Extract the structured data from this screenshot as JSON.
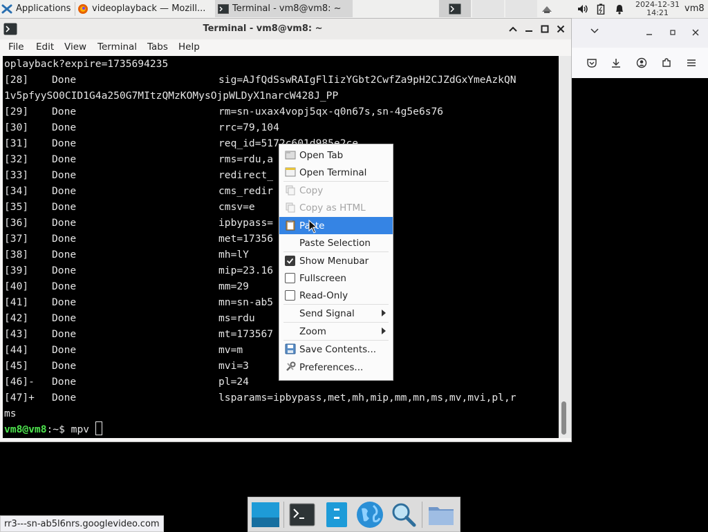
{
  "panel": {
    "apps_label": "Applications",
    "task1_label": "videoplayback — Mozill...",
    "task2_label": "Terminal - vm8@vm8: ~",
    "date": "2024-12-31",
    "time": "14:21",
    "user": "vm8"
  },
  "window": {
    "title": "Terminal - vm8@vm8: ~"
  },
  "menubar": [
    "File",
    "Edit",
    "View",
    "Terminal",
    "Tabs",
    "Help"
  ],
  "terminal": {
    "lines": [
      {
        "c1": "oplayback?expire=1735694235",
        "c2": "",
        "c3": ""
      },
      {
        "c1": "[28]",
        "c2": "Done",
        "c3": "sig=AJfQdSswRAIgFlIizYGbt2CwfZa9pH2CJZdGxYmeAzkQN"
      },
      {
        "c1": "1v5pfyySO0CID1G4a250G7MItzQMzKOMysOjpWLDyX1narcW428J_PP",
        "c2": "",
        "c3": ""
      },
      {
        "c1": "[29]",
        "c2": "Done",
        "c3": "rm=sn-uxax4vopj5qx-q0n67s,sn-4g5e6s76"
      },
      {
        "c1": "[30]",
        "c2": "Done",
        "c3": "rrc=79,104"
      },
      {
        "c1": "[31]",
        "c2": "Done",
        "c3": "req_id=5172c601d985e2ce"
      },
      {
        "c1": "[32]",
        "c2": "Done",
        "c3": "rms=rdu,a"
      },
      {
        "c1": "[33]",
        "c2": "Done",
        "c3": "redirect_"
      },
      {
        "c1": "[34]",
        "c2": "Done",
        "c3": "cms_redir"
      },
      {
        "c1": "[35]",
        "c2": "Done",
        "c3": "cmsv=e"
      },
      {
        "c1": "[36]",
        "c2": "Done",
        "c3": "ipbypass="
      },
      {
        "c1": "[37]",
        "c2": "Done",
        "c3": "met=17356"
      },
      {
        "c1": "[38]",
        "c2": "Done",
        "c3": "mh=lY"
      },
      {
        "c1": "[39]",
        "c2": "Done",
        "c3": "mip=23.16"
      },
      {
        "c1": "[40]",
        "c2": "Done",
        "c3": "mm=29"
      },
      {
        "c1": "[41]",
        "c2": "Done",
        "c3": "mn=sn-ab5"
      },
      {
        "c1": "[42]",
        "c2": "Done",
        "c3": "ms=rdu"
      },
      {
        "c1": "[43]",
        "c2": "Done",
        "c3": "mt=173567"
      },
      {
        "c1": "[44]",
        "c2": "Done",
        "c3": "mv=m"
      },
      {
        "c1": "[45]",
        "c2": "Done",
        "c3": "mvi=3"
      },
      {
        "c1": "[46]-",
        "c2": "Done",
        "c3": "pl=24"
      },
      {
        "c1": "[47]+",
        "c2": "Done",
        "c3": "lsparams=ipbypass,met,mh,mip,mm,mn,ms,mv,mvi,pl,r"
      },
      {
        "c1": "ms",
        "c2": "",
        "c3": ""
      }
    ],
    "prompt_user": "vm8@vm8",
    "prompt_sep": ":~$ ",
    "command": "mpv "
  },
  "context_menu": {
    "open_tab": "Open Tab",
    "open_terminal": "Open Terminal",
    "copy": "Copy",
    "copy_html": "Copy as HTML",
    "paste": "Paste",
    "paste_selection": "Paste Selection",
    "show_menubar": "Show Menubar",
    "fullscreen": "Fullscreen",
    "read_only": "Read-Only",
    "send_signal": "Send Signal",
    "zoom": "Zoom",
    "save_contents": "Save Contents...",
    "preferences": "Preferences..."
  },
  "checks": {
    "show_menubar": true,
    "fullscreen": false,
    "read_only": false
  },
  "status_url": "rr3---sn-ab5l6nrs.googlevideo.com",
  "colors": {
    "accent": "#3584e4",
    "prompt_green": "#4ee44e",
    "terminal_bg": "#000000"
  }
}
